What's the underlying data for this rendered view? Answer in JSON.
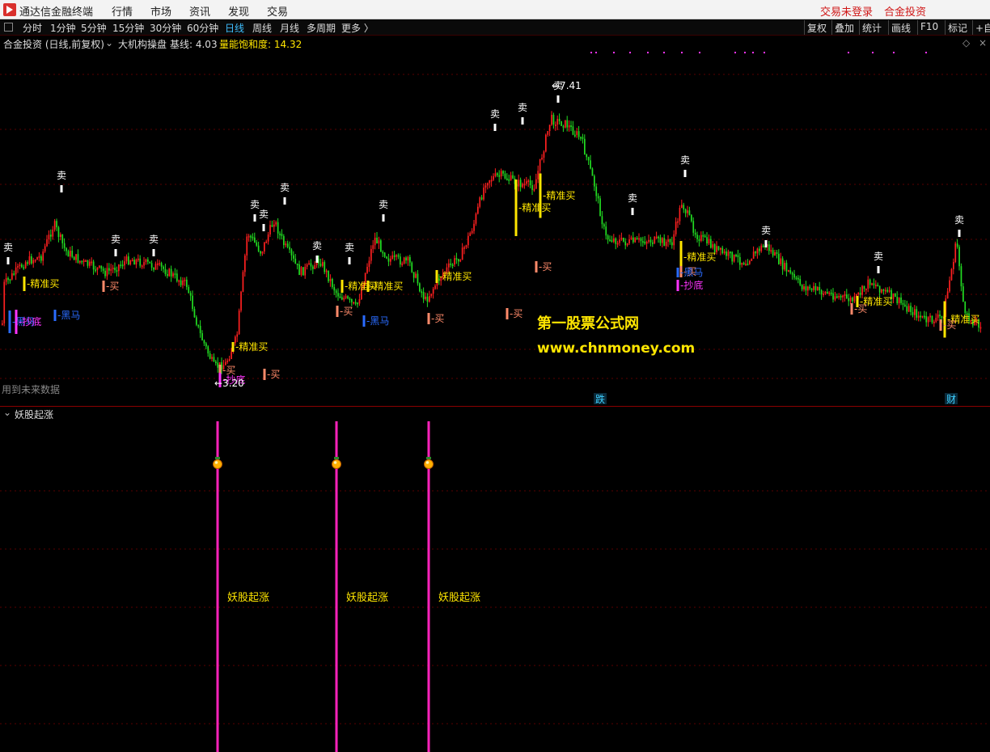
{
  "menubar": {
    "app_title": "通达信金融终端",
    "menus": [
      "行情",
      "市场",
      "资讯",
      "发现",
      "交易"
    ],
    "login_status": "交易未登录",
    "account": "合金投资"
  },
  "toolbar": {
    "periods": [
      "分时",
      "1分钟",
      "5分钟",
      "15分钟",
      "30分钟",
      "60分钟",
      "日线",
      "周线",
      "月线",
      "多周期",
      "更多 〉"
    ],
    "active_period": "日线",
    "right_buttons": [
      "复权",
      "叠加",
      "统计",
      "画线",
      "F10",
      "标记",
      "+自"
    ]
  },
  "info": {
    "stock": "合金投资 (日线,前复权)",
    "indicator": "大机构操盘",
    "baseline": "基线: 4.03",
    "saturation": "量能饱和度: 14.32"
  },
  "main_chart": {
    "high_label": "7.41",
    "low_label": "3.20",
    "future_note": "用到未来数据",
    "watermark_title": "第一股票公式网",
    "watermark_url": "www.chnmoney.com",
    "event_fall": "跌",
    "event_finance": "财",
    "sell_label": "卖",
    "buy_label": "-买",
    "precise_buy_label": "-精准买",
    "dark_horse_label": "-黑马",
    "bottom_label": "-抄底"
  },
  "sub_chart": {
    "title": "妖股起涨",
    "signal_label": "妖股起涨"
  },
  "colors": {
    "up": "#ff2020",
    "down": "#22dd22",
    "sell_mark": "#ffffff",
    "precise_buy": "#ffe600",
    "buy": "#ff8a6a",
    "dark_horse": "#2a6bff",
    "bottom": "#ff33ff",
    "signal_line": "#ff22bb",
    "grid": "#5a0000"
  }
}
